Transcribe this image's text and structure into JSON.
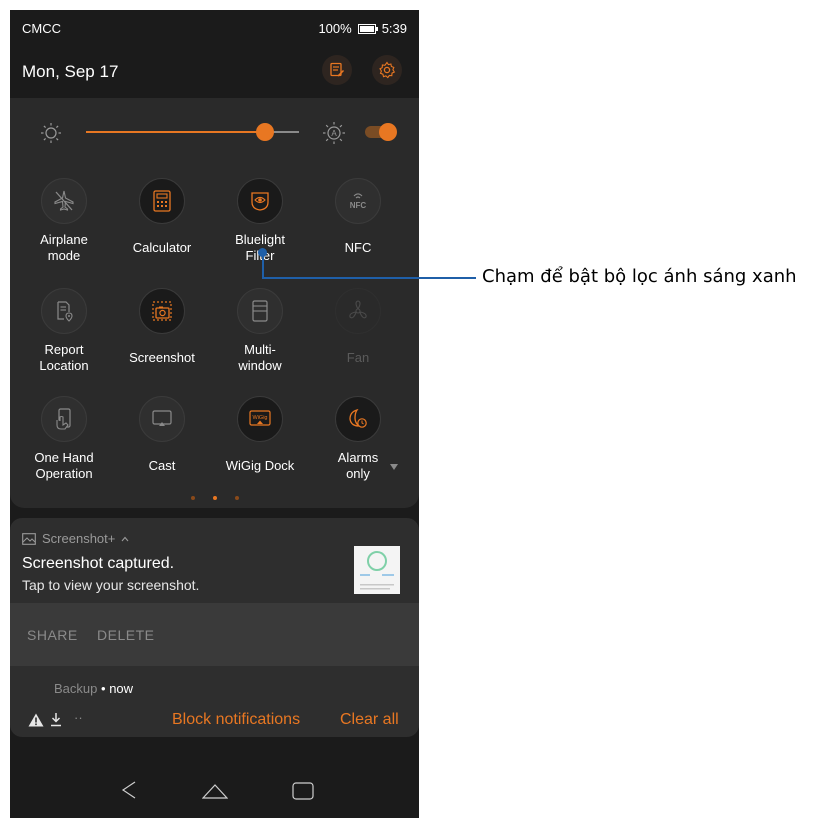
{
  "status_bar": {
    "carrier": "CMCC",
    "battery": "100%",
    "time": "5:39"
  },
  "header": {
    "date": "Mon, Sep 17",
    "edit_icon": "edit-icon",
    "settings_icon": "gear-icon"
  },
  "brightness": {
    "level": 0.84,
    "auto_enabled": true
  },
  "tiles": [
    {
      "label": "Airplane\nmode",
      "icon": "airplane-icon",
      "state": "off"
    },
    {
      "label": "Calculator",
      "icon": "calculator-icon",
      "state": "on"
    },
    {
      "label": "Bluelight\nFilter",
      "icon": "eye-filter-icon",
      "state": "on"
    },
    {
      "label": "NFC",
      "icon": "nfc-icon",
      "state": "off"
    },
    {
      "label": "Report\nLocation",
      "icon": "report-location-icon",
      "state": "off"
    },
    {
      "label": "Screenshot",
      "icon": "screenshot-icon",
      "state": "on"
    },
    {
      "label": "Multi-\nwindow",
      "icon": "multi-window-icon",
      "state": "off"
    },
    {
      "label": "Fan",
      "icon": "fan-icon",
      "state": "disabled"
    },
    {
      "label": "One Hand\nOperation",
      "icon": "one-hand-icon",
      "state": "off"
    },
    {
      "label": "Cast",
      "icon": "cast-icon",
      "state": "off"
    },
    {
      "label": "WiGig Dock",
      "icon": "wigig-icon",
      "state": "on",
      "badge": "WiGig"
    },
    {
      "label": "Alarms\nonly",
      "icon": "alarm-moon-icon",
      "state": "on"
    }
  ],
  "page_indicator": {
    "count": 3,
    "active": 1
  },
  "notification": {
    "app_name": "Screenshot+",
    "title": "Screenshot captured.",
    "body": "Tap to view your screenshot.",
    "actions": [
      "SHARE",
      "DELETE"
    ]
  },
  "backup": {
    "app": "Backup",
    "separator": "•",
    "time": "now"
  },
  "footer": {
    "block_label": "Block notifications",
    "clear_label": "Clear all",
    "more": "··"
  },
  "callout": {
    "text": "Chạm để bật bộ lọc ánh sáng xanh"
  },
  "colors": {
    "accent": "#e87722",
    "callout_line": "#1f5fa8"
  }
}
